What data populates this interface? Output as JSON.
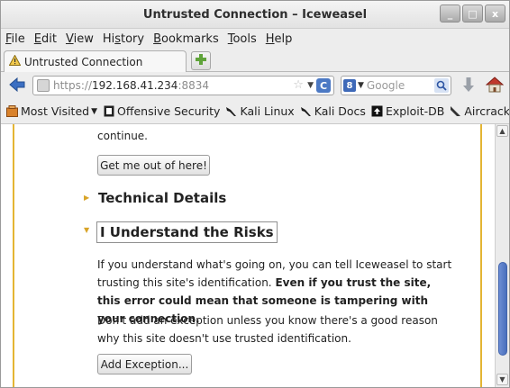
{
  "window": {
    "title": "Untrusted Connection – Iceweasel",
    "minimize_label": "_",
    "maximize_label": "□",
    "close_label": "x"
  },
  "menu": [
    {
      "ul": "F",
      "rest": "ile"
    },
    {
      "ul": "E",
      "rest": "dit"
    },
    {
      "ul": "V",
      "rest": "iew"
    },
    {
      "ul": "",
      "pre": "Hi",
      "ulmid": "s",
      "rest": "tory"
    },
    {
      "ul": "B",
      "rest": "ookmarks"
    },
    {
      "ul": "T",
      "rest": "ools"
    },
    {
      "ul": "H",
      "rest": "elp"
    }
  ],
  "tab": {
    "label": "Untrusted Connection",
    "new_tab_label": "+"
  },
  "nav": {
    "url_scheme": "https://",
    "url_host": "192.168.41.234",
    "url_port": ":8834",
    "search_placeholder": "Google",
    "search_engine_letter": "8",
    "reload_label": "C"
  },
  "bookmarks": [
    {
      "label": "Most Visited",
      "icon": "most-visited-icon",
      "dropdown": true
    },
    {
      "label": "Offensive Security",
      "icon": "offensive-security-icon"
    },
    {
      "label": "Kali Linux",
      "icon": "kali-dragon-icon"
    },
    {
      "label": "Kali Docs",
      "icon": "kali-dragon-icon"
    },
    {
      "label": "Exploit-DB",
      "icon": "exploit-db-icon"
    },
    {
      "label": "Aircrack-ng",
      "icon": "aircrack-icon"
    }
  ],
  "content": {
    "continue_text": "continue.",
    "get_out_button": "Get me out of here!",
    "technical_details": "Technical Details",
    "understand_risks": "I Understand the Risks",
    "para1_normal": "If you understand what's going on, you can tell Iceweasel to start trusting this site's identification. ",
    "para1_bold": "Even if you trust the site, this error could mean that someone is tampering with your connection.",
    "para2": "Don't add an exception unless you know there's a good reason why this site doesn't use trusted identification.",
    "add_exception_button": "Add Exception..."
  },
  "colors": {
    "accent_gold": "#e4b533",
    "scroll_thumb": "#5a7fc8"
  },
  "scroll": {
    "thumb_start": 0.53,
    "thumb_end": 0.93
  }
}
